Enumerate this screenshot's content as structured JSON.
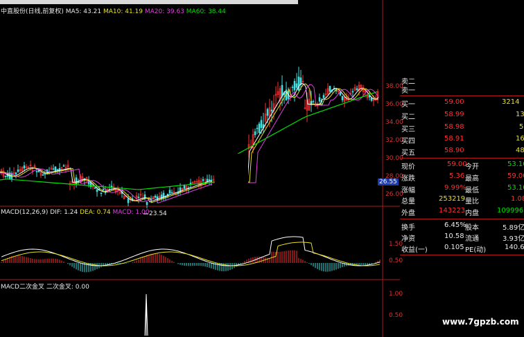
{
  "main_header": {
    "title": "中直股份(日线,前复权)",
    "ma5": "MA5: 43.21",
    "ma10": "MA10: 41.19",
    "ma20": "MA20: 39.63",
    "ma60": "MA60: 38.44"
  },
  "price_axis": [
    "38.00",
    "36.00",
    "34.00",
    "32.00",
    "30.00",
    "28.00",
    "26.00"
  ],
  "current_price_tag": "26.55",
  "low_marker": "23.54",
  "macd_header": {
    "name": "MACD(12,26,9)",
    "dif": "DIF: 1.24",
    "dea": "DEA: 0.74",
    "macd": "MACD: 1.00"
  },
  "macd_axis": [
    "1.50",
    "0.50"
  ],
  "cross_header": {
    "name": "MACD二次金叉",
    "value": "二次金叉: 0.00"
  },
  "cross_axis": [
    "1.00",
    "0.50"
  ],
  "quote": {
    "sell": [
      {
        "label": "卖二",
        "price": "",
        "vol": ""
      },
      {
        "label": "卖一",
        "price": "",
        "vol": ""
      }
    ],
    "buy": [
      {
        "label": "买一",
        "price": "59.00",
        "vol": "3214"
      },
      {
        "label": "买二",
        "price": "58.99",
        "vol": "13"
      },
      {
        "label": "买三",
        "price": "58.98",
        "vol": "5"
      },
      {
        "label": "买四",
        "price": "58.91",
        "vol": "16"
      },
      {
        "label": "买五",
        "price": "58.90",
        "vol": "48"
      }
    ],
    "stats": [
      {
        "l1": "现价",
        "v1": "59.00",
        "l2": "今开",
        "v2": "53.10"
      },
      {
        "l1": "涨跌",
        "v1": "5.36",
        "l2": "最高",
        "v2": "59.00"
      },
      {
        "l1": "涨幅",
        "v1": "9.99%",
        "l2": "最低",
        "v2": "53.10"
      },
      {
        "l1": "总量",
        "v1": "253219",
        "l2": "量比",
        "v2": "1.08"
      },
      {
        "l1": "外盘",
        "v1": "143223",
        "l2": "内盘",
        "v2": "109996"
      }
    ],
    "extra": [
      {
        "l1": "换手",
        "v1": "6.45%",
        "l2": "股本",
        "v2": "5.89亿"
      },
      {
        "l1": "净资",
        "v1": "10.58",
        "l2": "流通",
        "v2": "3.93亿"
      },
      {
        "l1": "收益(一)",
        "v1": "0.105",
        "l2": "PE(动)",
        "v2": "140.6"
      }
    ]
  },
  "watermark": "www.7gpzb.com",
  "colors": {
    "up": "#ff3030",
    "down": "#40e0e0",
    "ma5": "#ffffff",
    "ma10": "#e8e020",
    "ma20": "#e040e0",
    "ma60": "#00e000",
    "grid": "#b01818"
  }
}
